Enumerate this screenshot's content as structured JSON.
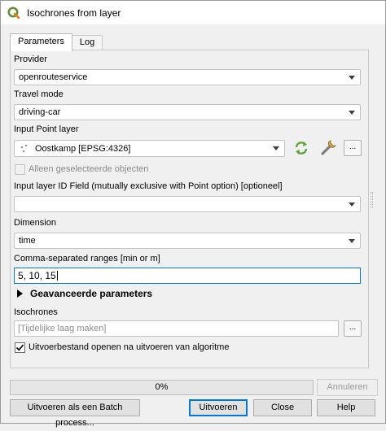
{
  "window": {
    "title": "Isochrones from layer"
  },
  "tabs": [
    {
      "label": "Parameters"
    },
    {
      "label": "Log"
    }
  ],
  "fields": {
    "provider": {
      "label": "Provider",
      "value": "openrouteservice"
    },
    "travel_mode": {
      "label": "Travel mode",
      "value": "driving-car"
    },
    "input_point_layer": {
      "label": "Input Point layer",
      "value": "Oostkamp [EPSG:4326]",
      "only_selected_label": "Alleen geselecteerde objecten",
      "more_button": "..."
    },
    "input_id_field": {
      "label": "Input layer ID Field (mutually exclusive with Point option) [optioneel]",
      "value": ""
    },
    "dimension": {
      "label": "Dimension",
      "value": "time"
    },
    "ranges": {
      "label": "Comma-separated ranges [min or m]",
      "value": "5, 10, 15"
    },
    "advanced": {
      "label": "Geavanceerde parameters"
    },
    "isochrones": {
      "label": "Isochrones",
      "placeholder": "[Tijdelijke laag maken]",
      "more_button": "...",
      "open_output_label": "Uitvoerbestand openen na uitvoeren van algoritme"
    }
  },
  "progress": {
    "text": "0%",
    "value": 0
  },
  "buttons": {
    "cancel": "Annuleren",
    "batch": "Uitvoeren als een Batch process...",
    "run": "Uitvoeren",
    "close": "Close",
    "help": "Help"
  },
  "icons": {
    "app": "qgis-logo-icon",
    "refresh": "iterate-icon",
    "advanced_toggle": "triangle-right-icon",
    "settings": "wrench-icon"
  },
  "colors": {
    "qgis_green": "#589632",
    "focus_blue": "#0078d7"
  }
}
